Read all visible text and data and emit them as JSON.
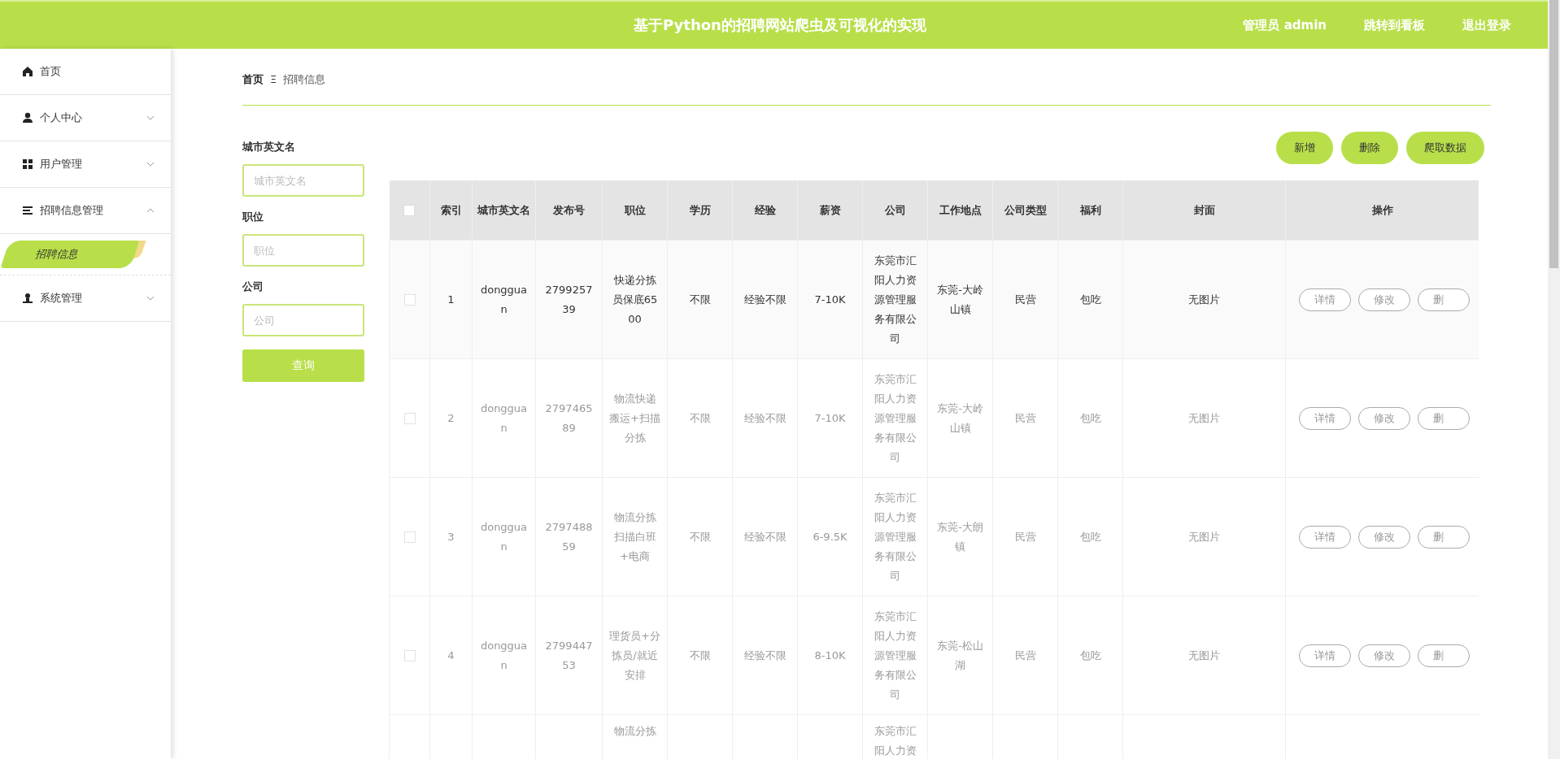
{
  "header": {
    "title": "基于Python的招聘网站爬虫及可视化的实现",
    "links": [
      "管理员 admin",
      "跳转到看板",
      "退出登录"
    ]
  },
  "sidebar": {
    "items": [
      {
        "kind": "home",
        "label": "首页"
      },
      {
        "kind": "user",
        "label": "个人中心",
        "expanded": false
      },
      {
        "kind": "grid",
        "label": "用户管理",
        "expanded": false
      },
      {
        "kind": "list",
        "label": "招聘信息管理",
        "expanded": true,
        "children": [
          {
            "label": "招聘信息",
            "selected": true
          }
        ]
      },
      {
        "kind": "admin",
        "label": "系统管理",
        "expanded": false
      }
    ]
  },
  "breadcrumb": {
    "home": "首页",
    "separator": "Ξ",
    "current": "招聘信息"
  },
  "search": {
    "fields": [
      {
        "label": "城市英文名",
        "placeholder": "城市英文名"
      },
      {
        "label": "职位",
        "placeholder": "职位"
      },
      {
        "label": "公司",
        "placeholder": "公司"
      }
    ],
    "button": "查询"
  },
  "actions": [
    "新增",
    "删除",
    "爬取数据"
  ],
  "table": {
    "all_checked": false,
    "columns": [
      "索引",
      "城市英文名",
      "发布号",
      "职位",
      "学历",
      "经验",
      "薪资",
      "公司",
      "工作地点",
      "公司类型",
      "福利",
      "封面",
      "操作"
    ],
    "rows": [
      {
        "highlighted": true,
        "checked": false,
        "cells": [
          "1",
          "dongguan",
          "279925739",
          "快递分拣员保底6500",
          "不限",
          "经验不限",
          "7-10K",
          "东莞市汇阳人力资源管理服务有限公司",
          "东莞-大岭山镇",
          "民营",
          "包吃",
          "无图片"
        ],
        "buttons": [
          "详情",
          "修改",
          "删"
        ]
      },
      {
        "highlighted": false,
        "checked": false,
        "cells": [
          "2",
          "dongguan",
          "279746589",
          "物流快递搬运+扫描分拣",
          "不限",
          "经验不限",
          "7-10K",
          "东莞市汇阳人力资源管理服务有限公司",
          "东莞-大岭山镇",
          "民营",
          "包吃",
          "无图片"
        ],
        "buttons": [
          "详情",
          "修改",
          "删"
        ]
      },
      {
        "highlighted": false,
        "checked": false,
        "cells": [
          "3",
          "dongguan",
          "279748859",
          "物流分拣扫描白班+电商",
          "不限",
          "经验不限",
          "6-9.5K",
          "东莞市汇阳人力资源管理服务有限公司",
          "东莞-大朗镇",
          "民营",
          "包吃",
          "无图片"
        ],
        "buttons": [
          "详情",
          "修改",
          "删"
        ]
      },
      {
        "highlighted": false,
        "checked": false,
        "cells": [
          "4",
          "dongguan",
          "279944753",
          "理货员+分拣员/就近安排",
          "不限",
          "经验不限",
          "8-10K",
          "东莞市汇阳人力资源管理服务有限公司",
          "东莞-松山湖",
          "民营",
          "包吃",
          "无图片"
        ],
        "buttons": [
          "详情",
          "修改",
          "删"
        ]
      },
      {
        "kind": "partial",
        "cells": [
          "",
          "",
          "",
          "物流分拣",
          "",
          "",
          "",
          "东莞市汇阳人力资",
          "",
          "",
          "",
          ""
        ]
      }
    ]
  }
}
